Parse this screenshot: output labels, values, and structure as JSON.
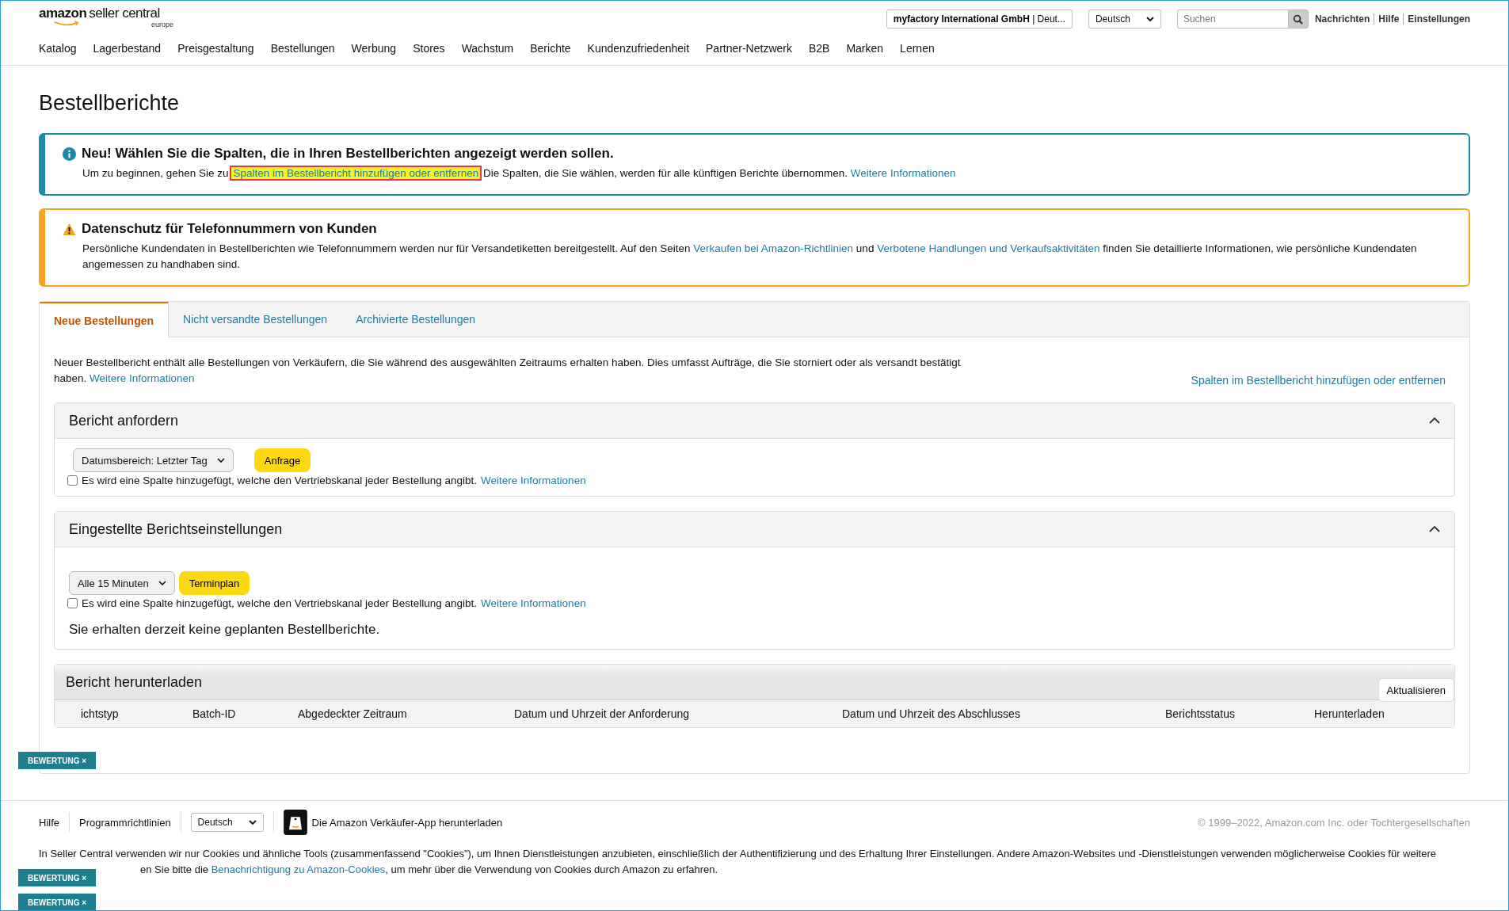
{
  "header": {
    "logo": {
      "brand": "amazon",
      "product": "seller central",
      "region": "europe"
    },
    "account": {
      "name": "myfactory International GmbH",
      "separator": "|",
      "market": "Deut..."
    },
    "language": "Deutsch",
    "search": {
      "placeholder": "Suchen"
    },
    "links": [
      "Nachrichten",
      "Hilfe",
      "Einstellungen"
    ]
  },
  "nav": [
    "Katalog",
    "Lagerbestand",
    "Preisgestaltung",
    "Bestellungen",
    "Werbung",
    "Stores",
    "Wachstum",
    "Berichte",
    "Kundenzufriedenheit",
    "Partner-Netzwerk",
    "B2B",
    "Marken",
    "Lernen"
  ],
  "title": "Bestellberichte",
  "alerts": [
    {
      "kind": "info",
      "title": "Neu! Wählen Sie die Spalten, die in Ihren Bestellberichten angezeigt werden sollen.",
      "parts": [
        {
          "text": "Um zu beginnen, gehen Sie zu "
        },
        {
          "link": "Spalten im Bestellbericht hinzufügen oder entfernen",
          "highlighted": true
        },
        {
          "text": " Die Spalten, die Sie wählen, werden für alle künftigen Berichte übernommen. "
        },
        {
          "link": "Weitere Informationen",
          "highlighted": false
        }
      ]
    },
    {
      "kind": "warning",
      "title": "Datenschutz für Telefonnummern von Kunden",
      "parts": [
        {
          "text": "Persönliche Kundendaten in Bestellberichten wie Telefonnummern werden nur für Versandetiketten bereitgestellt. Auf den Seiten "
        },
        {
          "link": "Verkaufen bei Amazon-Richtlinien",
          "highlighted": false
        },
        {
          "text": " und "
        },
        {
          "link": "Verbotene Handlungen und Verkaufsaktivitäten",
          "highlighted": false
        },
        {
          "text": " finden Sie detaillierte Informationen, wie persönliche Kundendaten angemessen zu handhaben sind."
        }
      ]
    }
  ],
  "tabs": [
    {
      "label": "Neue Bestellungen",
      "selected": true
    },
    {
      "label": "Nicht versandte Bestellungen",
      "selected": false
    },
    {
      "label": "Archivierte Bestellungen",
      "selected": false
    }
  ],
  "intro": {
    "text": "Neuer Bestellbericht enthält alle Bestellungen von Verkäufern, die Sie während des ausgewählten Zeitraums erhalten haben. Dies umfasst Aufträge, die Sie storniert oder als versandt bestätigt haben.",
    "link": "Weitere Informationen",
    "side_link": "Spalten im Bestellbericht hinzufügen oder entfernen"
  },
  "request_panel": {
    "title": "Bericht anfordern",
    "expanded": true,
    "select": "Datumsbereich: Letzter Tag",
    "button": "Anfrage",
    "checkbox": {
      "label": "Es wird eine Spalte hinzugefügt, welche den Vertriebskanal jeder Bestellung angibt.",
      "checked": false,
      "link": "Weitere Informationen"
    }
  },
  "schedule_panel": {
    "title": "Eingestellte Berichtseinstellungen",
    "expanded": true,
    "select": "Alle 15 Minuten",
    "button": "Terminplan",
    "checkbox": {
      "label": "Es wird eine Spalte hinzugefügt, welche den Vertriebskanal jeder Bestellung angibt.",
      "checked": false,
      "link": "Weitere Informationen"
    },
    "message": "Sie erhalten derzeit keine geplanten Bestellberichte."
  },
  "download_panel": {
    "title": "Bericht herunterladen",
    "button": "Aktualisieren",
    "columns": [
      "ichtstyp",
      "Batch-ID",
      "Abgedeckter Zeitraum",
      "Datum und Uhrzeit der Anforderung",
      "Datum und Uhrzeit des Abschlusses",
      "Berichtsstatus",
      "Herunterladen"
    ]
  },
  "footer": {
    "links": [
      "Hilfe",
      "Programmrichtlinien"
    ],
    "language": "Deutsch",
    "app_link": "Die Amazon Verkäufer-App herunterladen",
    "copyright": "© 1999–2022, Amazon.com Inc. oder Tochtergesellschaften",
    "cookie_line_1": "In Seller Central verwenden wir nur Cookies und ähnliche Tools (zusammenfassend \"Cookies\"), um Ihnen Dienstleistungen anzubieten, einschließlich der Authentifizierung und des Erhaltung Ihrer Einstellungen. Andere Amazon-Websites und -Dienstleistungen verwenden möglicherweise Cookies für weitere",
    "cookie_line_2": [
      {
        "text": "en Sie bitte die "
      },
      {
        "link": "Benachrichtigung zu Amazon-Cookies"
      },
      {
        "text": ", um mehr über die Verwendung von Cookies durch Amazon zu erfahren."
      }
    ]
  },
  "feedback_badges": [
    "BEWERTUNG ×",
    "BEWERTUNG ×",
    "BEWERTUNG ×"
  ]
}
